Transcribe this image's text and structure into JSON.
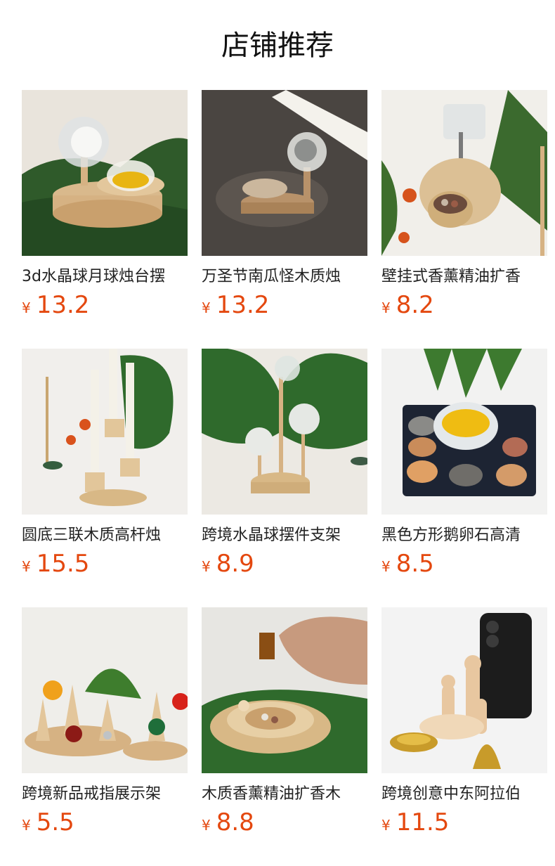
{
  "section_title": "店铺推荐",
  "accent_color": "#e4480f",
  "currency": "¥",
  "products": [
    {
      "name": "3d水晶球月球烛台摆",
      "price": "13.2",
      "image": "crystal-ball-candle-holder-leaf"
    },
    {
      "name": "万圣节南瓜怪木质烛",
      "price": "13.2",
      "image": "crystal-ball-candle-holder-dark"
    },
    {
      "name": "壁挂式香薰精油扩香",
      "price": "8.2",
      "image": "wall-hanging-aroma-diffuser"
    },
    {
      "name": "圆底三联木质高杆烛",
      "price": "15.5",
      "image": "triple-wooden-candlestick"
    },
    {
      "name": "跨境水晶球摆件支架",
      "price": "8.9",
      "image": "crystal-ball-stand"
    },
    {
      "name": "黑色方形鹅卵石高清",
      "price": "8.5",
      "image": "black-pebble-candle-tray"
    },
    {
      "name": "跨境新品戒指展示架",
      "price": "5.5",
      "image": "ring-display-cones"
    },
    {
      "name": "木质香薰精油扩香木",
      "price": "8.8",
      "image": "wooden-oil-diffuser-ring"
    },
    {
      "name": "跨境创意中东阿拉伯",
      "price": "11.5",
      "image": "wooden-peg-dolls-brass-bowl"
    }
  ]
}
